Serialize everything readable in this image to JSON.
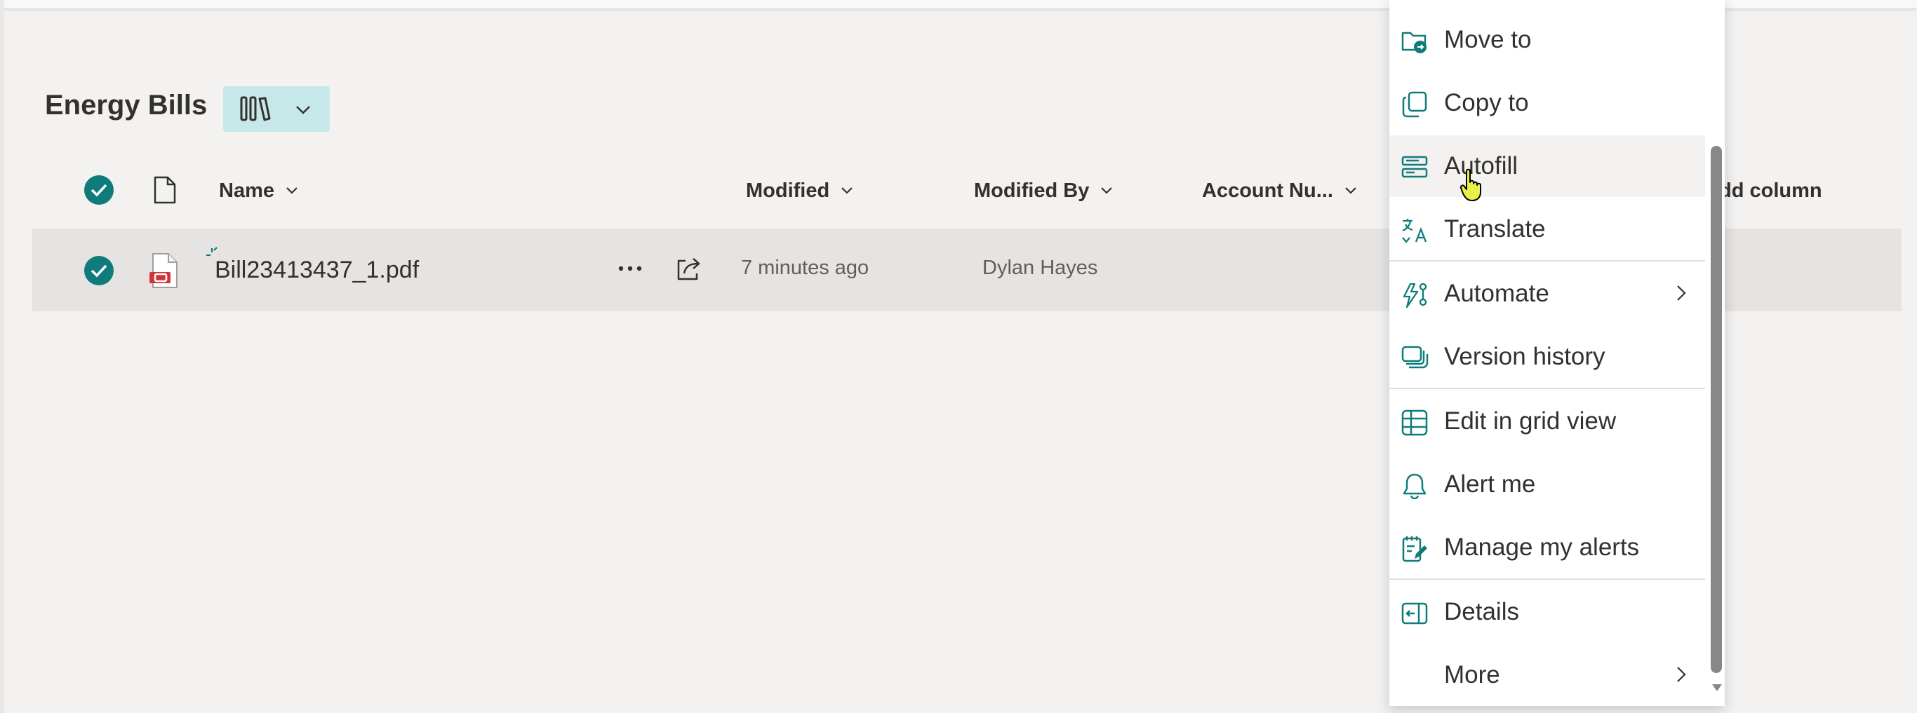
{
  "library": {
    "title": "Energy Bills",
    "view_button_icon": "library-icon"
  },
  "columns": {
    "name": "Name",
    "modified": "Modified",
    "modified_by": "Modified By",
    "account_number": "Account Nu...",
    "add_column": "dd column"
  },
  "file": {
    "name": "Bill23413437_1.pdf",
    "modified": "7 minutes ago",
    "modified_by": "Dylan Hayes",
    "type_icon": "pdf-file-icon"
  },
  "context_menu": {
    "items": [
      {
        "label": "Move to",
        "icon": "move-folder-icon"
      },
      {
        "label": "Copy to",
        "icon": "copy-icon"
      },
      {
        "label": "Autofill",
        "icon": "autofill-icon"
      },
      {
        "label": "Translate",
        "icon": "translate-icon"
      },
      {
        "label": "Automate",
        "icon": "automate-icon"
      },
      {
        "label": "Version history",
        "icon": "version-history-icon"
      },
      {
        "label": "Edit in grid view",
        "icon": "grid-view-icon"
      },
      {
        "label": "Alert me",
        "icon": "bell-icon"
      },
      {
        "label": "Manage my alerts",
        "icon": "manage-alerts-icon"
      },
      {
        "label": "Details",
        "icon": "details-icon"
      },
      {
        "label": "More",
        "icon": ""
      }
    ],
    "hovered": "Autofill",
    "accent": "#0f7b7b"
  }
}
